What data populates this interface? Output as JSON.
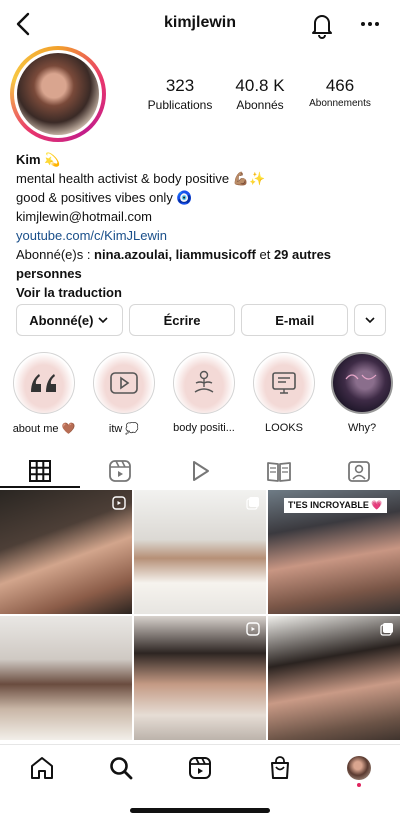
{
  "header": {
    "username": "kimjlewin"
  },
  "stats": [
    {
      "value": "323",
      "label": "Publications"
    },
    {
      "value": "40.8 K",
      "label": "Abonnés"
    },
    {
      "value": "466",
      "label": "Abonnements"
    }
  ],
  "bio": {
    "name": "Kim 💫",
    "line1": "mental health activist & body positive 💪🏽✨",
    "line2": "good & positives vibes only 🧿",
    "email": "kimjlewin@hotmail.com",
    "link": "youtube.com/c/KimJLewin",
    "followed_prefix": "Abonné(e)s : ",
    "followed_names": "nina.azoulai, liammusicoff",
    "followed_mid": " et ",
    "followed_more": "29 autres personnes",
    "translate": "Voir la traduction"
  },
  "actions": {
    "following": "Abonné(e)",
    "message": "Écrire",
    "email": "E-mail"
  },
  "highlights": [
    {
      "label": "about me 🤎",
      "icon": "quote-icon"
    },
    {
      "label": "itw 💭",
      "icon": "play-icon"
    },
    {
      "label": "body positi...",
      "icon": "meditation-icon"
    },
    {
      "label": "LOOKS",
      "icon": "tv-icon"
    },
    {
      "label": "Why?",
      "icon": "photo"
    }
  ],
  "grid": {
    "overlay_text": "T'ES INCROYABLE 💗"
  },
  "colors": {
    "link": "#1a4f8a",
    "notification_dot": "#e0245e"
  }
}
